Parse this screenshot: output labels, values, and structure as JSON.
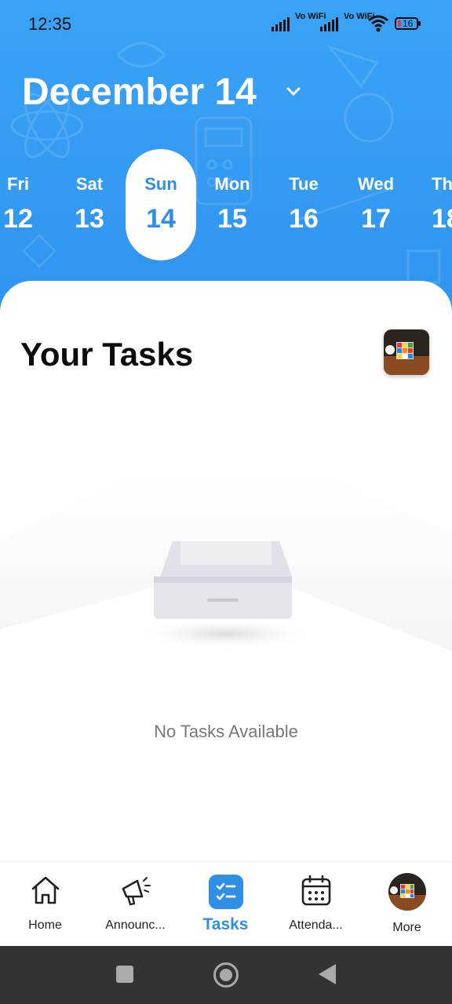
{
  "status": {
    "time": "12:35",
    "network1": "Vo WiFi",
    "network2": "Vo WiFi",
    "battery": "16"
  },
  "header": {
    "month_label": "December 14"
  },
  "days": [
    {
      "name": "Fri",
      "num": "12"
    },
    {
      "name": "Sat",
      "num": "13"
    },
    {
      "name": "Sun",
      "num": "14",
      "selected": true
    },
    {
      "name": "Mon",
      "num": "15"
    },
    {
      "name": "Tue",
      "num": "16"
    },
    {
      "name": "Wed",
      "num": "17"
    },
    {
      "name": "Th",
      "num": "18"
    }
  ],
  "tasks": {
    "title": "Your Tasks",
    "empty_text": "No Tasks Available"
  },
  "nav": {
    "home": "Home",
    "announcements": "Announc...",
    "tasks": "Tasks",
    "attendance": "Attenda...",
    "more": "More"
  },
  "colors": {
    "header_bg": "#2f93ef",
    "accent": "#2f8fe4"
  }
}
